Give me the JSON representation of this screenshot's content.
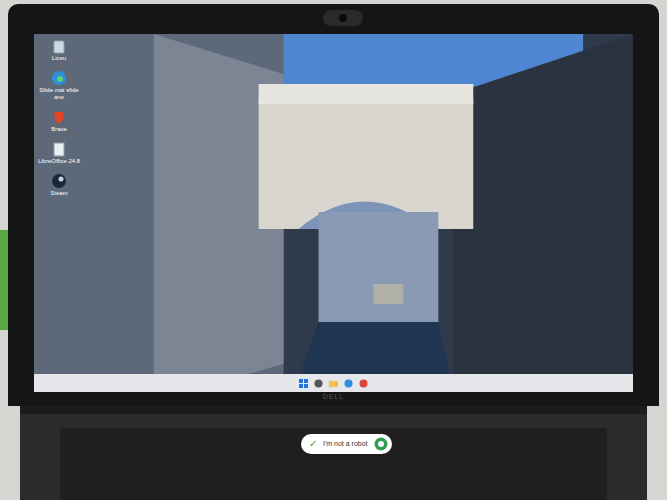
{
  "desktop": {
    "icons": [
      {
        "label": "Liceu",
        "kind": "bin"
      },
      {
        "label": "Sfide mai sfide ane",
        "kind": "edge"
      },
      {
        "label": "Brave",
        "kind": "brave"
      },
      {
        "label": "LibreOffice 24.8",
        "kind": "doc"
      },
      {
        "label": "Steam",
        "kind": "steam"
      }
    ]
  },
  "taskbar": {
    "apps": [
      {
        "kind": "start"
      },
      {
        "kind": "search"
      },
      {
        "kind": "folder"
      },
      {
        "kind": "edge"
      },
      {
        "kind": "chrome"
      }
    ]
  },
  "laptop": {
    "brand": "DELL"
  },
  "captcha": {
    "label": "I'm not a robot",
    "checked": true
  }
}
